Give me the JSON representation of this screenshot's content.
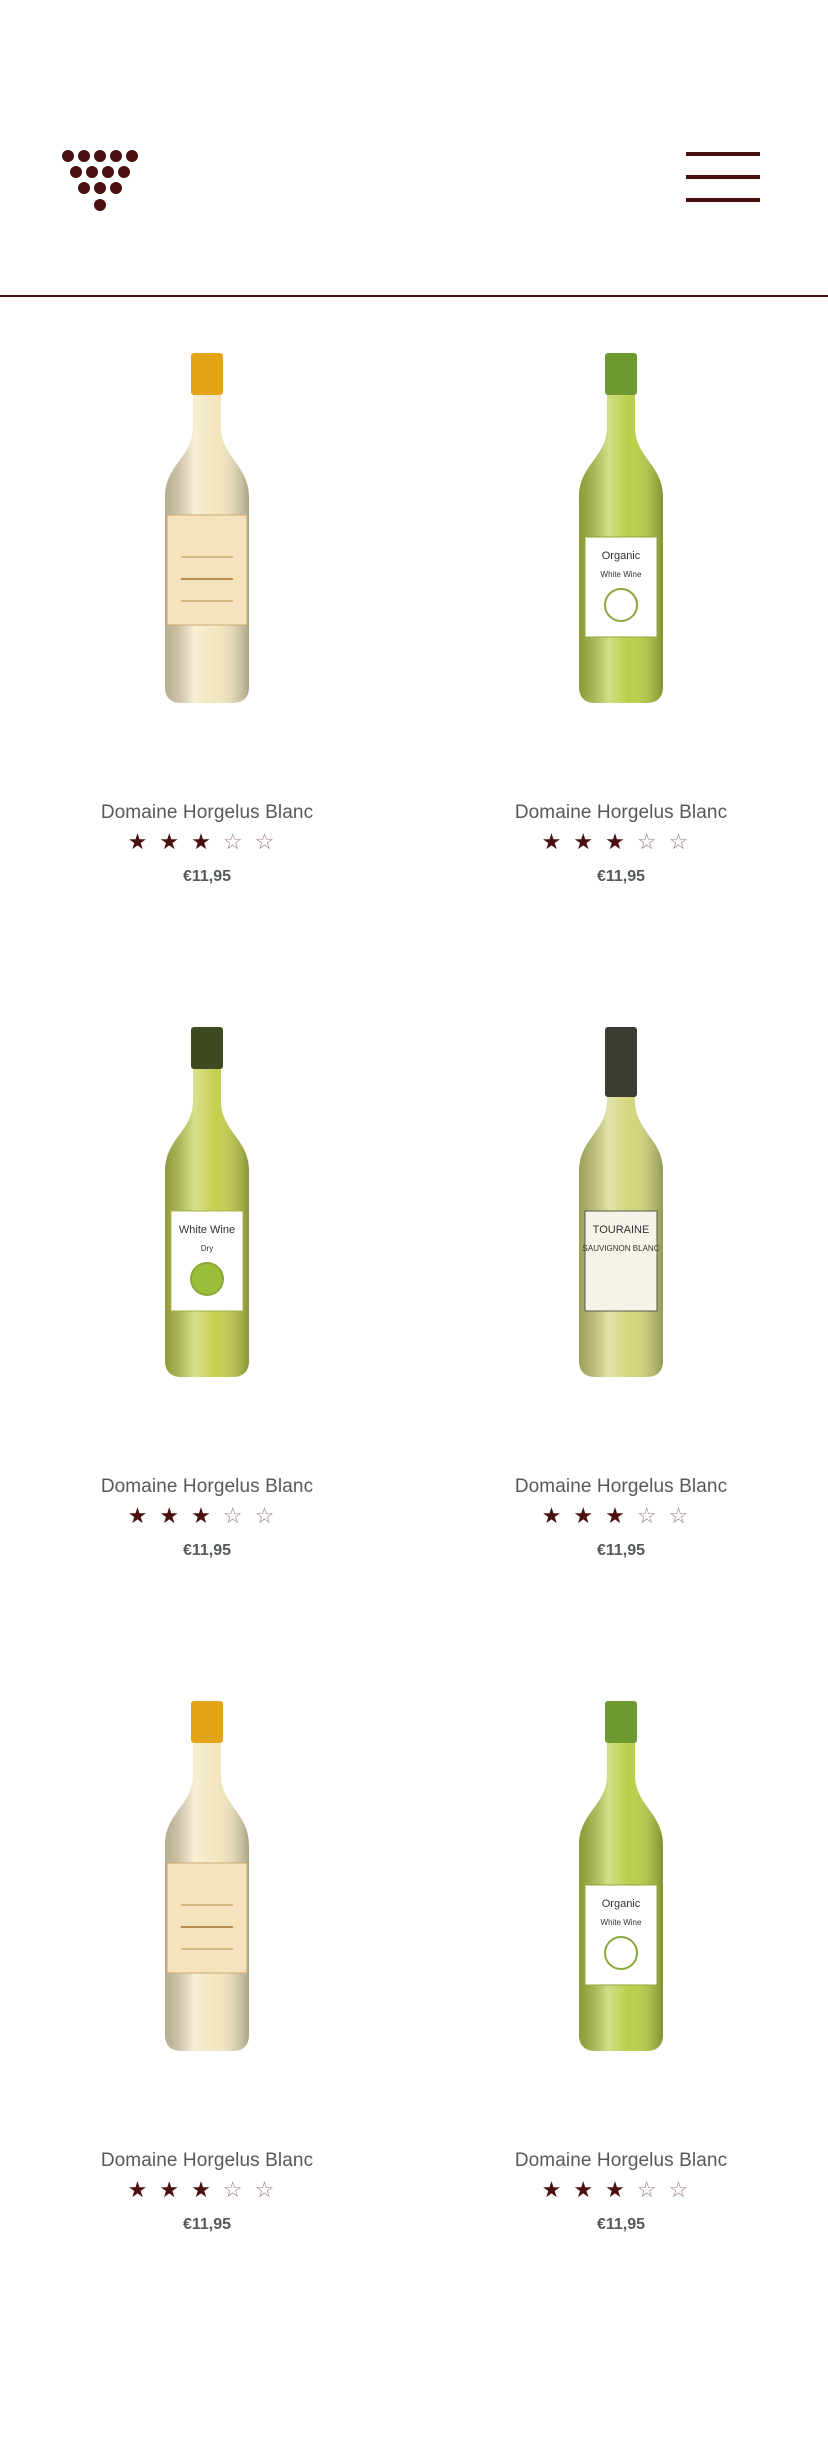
{
  "header": {
    "logo_icon": "grape-cluster-logo-icon",
    "menu_icon": "hamburger-menu-icon",
    "accent_color": "#4a0f0f"
  },
  "products": [
    {
      "name": "Domaine Horgelus Blanc",
      "rating": 3,
      "rating_max": 5,
      "price": "€11,95",
      "bottle": "golden-sweet-wine"
    },
    {
      "name": "Domaine Horgelus Blanc",
      "rating": 3,
      "rating_max": 5,
      "price": "€11,95",
      "bottle": "green-organic-white"
    },
    {
      "name": "Domaine Horgelus Blanc",
      "rating": 3,
      "rating_max": 5,
      "price": "€11,95",
      "bottle": "white-wine-dry"
    },
    {
      "name": "Domaine Horgelus Blanc",
      "rating": 3,
      "rating_max": 5,
      "price": "€11,95",
      "bottle": "touraine-sauvignon-blanc"
    },
    {
      "name": "Domaine Horgelus Blanc",
      "rating": 3,
      "rating_max": 5,
      "price": "€11,95",
      "bottle": "golden-sweet-wine"
    },
    {
      "name": "Domaine Horgelus Blanc",
      "rating": 3,
      "rating_max": 5,
      "price": "€11,95",
      "bottle": "green-organic-white"
    }
  ],
  "bottle_labels": {
    "green-organic-white": [
      "Organic",
      "White Wine"
    ],
    "white-wine-dry": [
      "White Wine",
      "Dry"
    ],
    "touraine-sauvignon-blanc": [
      "TOURAINE",
      "SAUVIGNON BLANC"
    ]
  }
}
